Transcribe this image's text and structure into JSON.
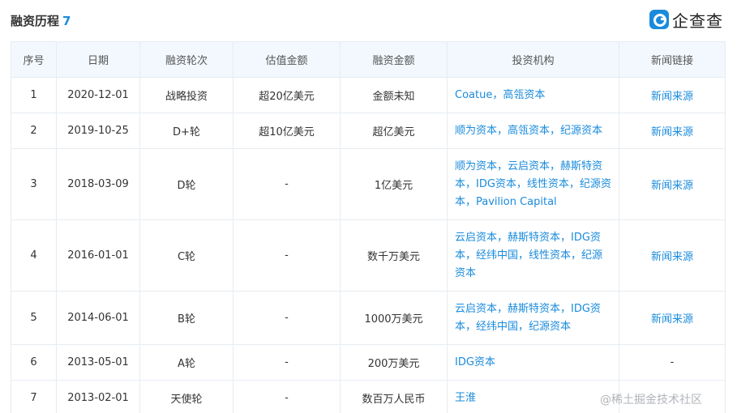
{
  "header": {
    "title": "融资历程",
    "count": "7",
    "brand": "企查查"
  },
  "columns": [
    "序号",
    "日期",
    "融资轮次",
    "估值金额",
    "融资金额",
    "投资机构",
    "新闻链接"
  ],
  "rows": [
    {
      "no": "1",
      "date": "2020-12-01",
      "round": "战略投资",
      "valuation": "超20亿美元",
      "amount": "金额未知",
      "investors": "Coatue，高瓴资本",
      "news": "新闻来源"
    },
    {
      "no": "2",
      "date": "2019-10-25",
      "round": "D+轮",
      "valuation": "超10亿美元",
      "amount": "超亿美元",
      "investors": "顺为资本，高瓴资本，纪源资本",
      "news": "新闻来源"
    },
    {
      "no": "3",
      "date": "2018-03-09",
      "round": "D轮",
      "valuation": "-",
      "amount": "1亿美元",
      "investors": "顺为资本，云启资本，赫斯特资本，IDG资本，线性资本，纪源资本，Pavilion Capital",
      "news": "新闻来源"
    },
    {
      "no": "4",
      "date": "2016-01-01",
      "round": "C轮",
      "valuation": "-",
      "amount": "数千万美元",
      "investors": "云启资本，赫斯特资本，IDG资本，经纬中国，线性资本，纪源资本",
      "news": "新闻来源"
    },
    {
      "no": "5",
      "date": "2014-06-01",
      "round": "B轮",
      "valuation": "-",
      "amount": "1000万美元",
      "investors": "云启资本，赫斯特资本，IDG资本，经纬中国，纪源资本",
      "news": "新闻来源"
    },
    {
      "no": "6",
      "date": "2013-05-01",
      "round": "A轮",
      "valuation": "-",
      "amount": "200万美元",
      "investors": "IDG资本",
      "news": "-"
    },
    {
      "no": "7",
      "date": "2013-02-01",
      "round": "天使轮",
      "valuation": "-",
      "amount": "数百万人民币",
      "investors": "王淮",
      "news": ""
    }
  ],
  "watermark": "@稀土掘金技术社区",
  "colors": {
    "accent": "#1a8bdc",
    "header_bg": "#f2f8fd",
    "border": "#e6ecf2"
  }
}
